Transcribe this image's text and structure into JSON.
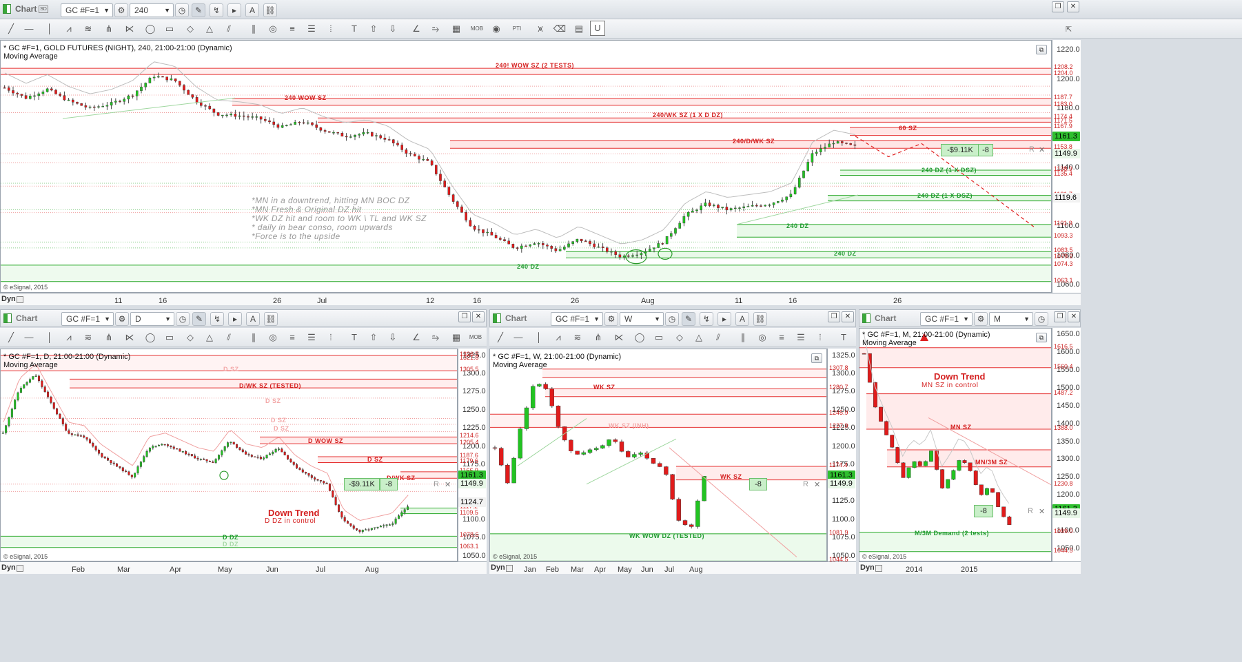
{
  "window": {
    "title": "Chart",
    "symbol": "GC #F=1",
    "interval": "240"
  },
  "main": {
    "header": "* GC #F=1, GOLD FUTURES (NIGHT), 240, 21:00-21:00 (Dynamic)",
    "study": "Moving Average",
    "copyright": "© eSignal, 2015",
    "dyn": "Dyn",
    "x_ticks": [
      "11",
      "16",
      "26",
      "Jul",
      "12",
      "16",
      "26",
      "Aug",
      "11",
      "16",
      "26"
    ],
    "y_ticks": [
      "1220.0",
      "1200.0",
      "1180.0",
      "1160.0",
      "1140.0",
      "1120.0",
      "1100.0",
      "1080.0",
      "1060.0"
    ],
    "levels": [
      "1208.2",
      "1204.0",
      "1187.7",
      "1183.0",
      "1174.4",
      "1171.5",
      "1167.9",
      "1162.5",
      "1159.1",
      "1153.8",
      "1138.9",
      "1135.4",
      "1121.7",
      "1118.0",
      "1101.9",
      "1093.3",
      "1083.5",
      "1079.2",
      "1074.3",
      "1063.1"
    ],
    "current_price": "1161.3",
    "bid_price": "1149.9",
    "mid_price": "1119.6",
    "zones": {
      "z1": "240! WOW SZ (2 TESTS)",
      "z2": "240 WOW SZ",
      "z3": "240/WK SZ (1 X D DZ)",
      "z4": "60 SZ",
      "z5": "240/D/WK SZ",
      "z6": "240 DZ (1 X DSZ)",
      "z7": "240 DZ (1 X DSZ)",
      "z8": "240 DZ",
      "z9": "240 DZ",
      "z10": "240 DZ"
    },
    "notes": [
      "*MN in a downtrend, hitting MN BOC DZ",
      "*MN Fresh & Original DZ hit",
      "*WK DZ hit and room to WK \\ TL and WK SZ",
      "* daily in bear conso, room upwards",
      "*Force is to the upside"
    ],
    "position": {
      "pnl": "-$9.11K",
      "qty": "-8"
    }
  },
  "daily": {
    "symbol": "GC #F=1",
    "interval": "D",
    "header": "* GC #F=1, D, 21:00-21:00 (Dynamic)",
    "study": "Moving Average",
    "copyright": "© eSignal, 2015",
    "dyn": "Dyn",
    "x_ticks": [
      "Feb",
      "Mar",
      "Apr",
      "May",
      "Jun",
      "Jul",
      "Aug"
    ],
    "y_ticks": [
      "1325.0",
      "1300.0",
      "1275.0",
      "1250.0",
      "1225.0",
      "1200.0",
      "1175.0",
      "1150.0",
      "1125.0",
      "1100.0",
      "1075.0",
      "1050.0"
    ],
    "levels": [
      "1326.5",
      "1321.8",
      "1305.5",
      "1214.6",
      "1205.4",
      "1187.6",
      "1179.6",
      "1166.9",
      "1117.2",
      "1109.5",
      "1078.6",
      "1063.1"
    ],
    "current_price": "1161.3",
    "bid_price": "1149.9",
    "mid_price": "1124.7",
    "zones": {
      "a": "D SZ",
      "b": "D/WK SZ (TESTED)",
      "c": "D SZ",
      "d": "D SZ",
      "e": "D SZ",
      "f": "D WOW SZ",
      "g": "D SZ",
      "h": "D/WK SZ",
      "i": "D DZ",
      "j": "D DZ"
    },
    "trend_title": "Down Trend",
    "trend_sub": "D DZ in control",
    "position": {
      "pnl": "-$9.11K",
      "qty": "-8"
    }
  },
  "weekly": {
    "symbol": "GC #F=1",
    "interval": "W",
    "header": "* GC #F=1, W, 21:00-21:00 (Dynamic)",
    "study": "Moving Average",
    "copyright": "© eSignal, 2015",
    "dyn": "Dyn",
    "x_ticks": [
      "Jan",
      "Feb",
      "Mar",
      "Apr",
      "May",
      "Jun",
      "Jul",
      "Aug"
    ],
    "y_ticks": [
      "1325.0",
      "1300.0",
      "1275.0",
      "1250.0",
      "1225.0",
      "1200.0",
      "1175.0",
      "1150.0",
      "1125.0",
      "1100.0",
      "1075.0",
      "1050.0"
    ],
    "levels": [
      "1307.8",
      "1280.7",
      "1245.9",
      "1227.9",
      "1174.4",
      "1155.8",
      "1081.9",
      "1044.5"
    ],
    "current_price": "1161.3",
    "bid_price": "1149.9",
    "zones": {
      "a": "WK SZ",
      "b": "WK SZ",
      "c": "WK SZ (INH)",
      "d": "WK SZ",
      "e": "WK WOW DZ (TESTED)"
    },
    "position": {
      "qty": "-8"
    }
  },
  "monthly": {
    "symbol": "GC #F=1",
    "interval": "M",
    "header": "* GC #F=1, M, 21:00-21:00 (Dynamic)",
    "study": "Moving Average",
    "copyright": "© eSignal, 2015",
    "dyn": "Dyn",
    "x_ticks": [
      "2014",
      "2015"
    ],
    "y_ticks": [
      "1650.0",
      "1600.0",
      "1550.0",
      "1500.0",
      "1450.0",
      "1400.0",
      "1350.0",
      "1300.0",
      "1250.0",
      "1200.0",
      "1150.0",
      "1100.0",
      "1050.0"
    ],
    "levels": [
      "1616.5",
      "1560.4",
      "1487.2",
      "1388.0",
      "1230.8",
      "1099.0",
      "1044.5"
    ],
    "current_price": "1161.3",
    "bid_price": "1149.9",
    "trend_title": "Down Trend",
    "trend_sub": "MN SZ in control",
    "zones": {
      "a": "MN SZ",
      "b": "MN/3M SZ",
      "c": "M/3M Demand (2 tests)"
    },
    "position": {
      "qty": "-8"
    }
  }
}
